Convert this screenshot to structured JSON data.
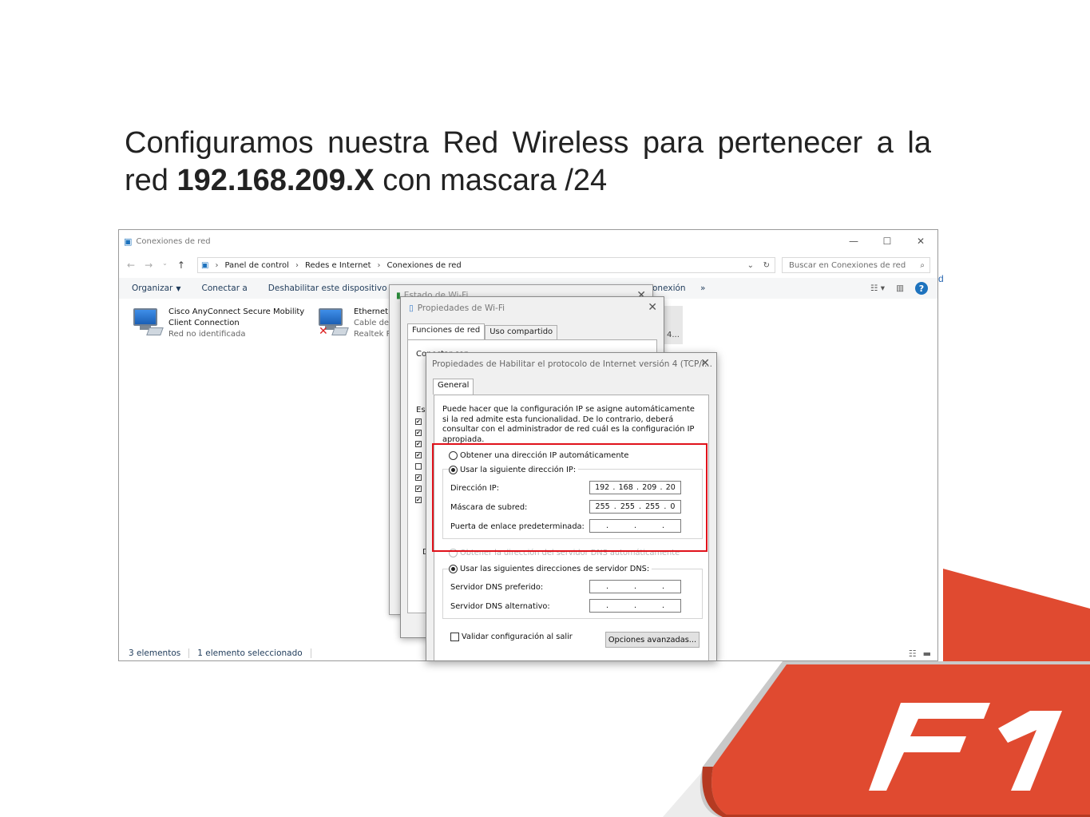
{
  "slide": {
    "title_part1": "Configuramos nuestra Red Wireless para pertenecer a la red ",
    "title_bold": "192.168.209.X",
    "title_part2": " con mascara /24"
  },
  "explorer": {
    "title": "Conexiones de red",
    "breadcrumb": [
      "Panel de control",
      "Redes e Internet",
      "Conexiones de red"
    ],
    "search_placeholder": "Buscar en Conexiones de red",
    "toolbar": {
      "organize": "Organizar",
      "connect": "Conectar a",
      "disable": "Deshabilitar este dispositivo de r",
      "connection_frag": "onexión",
      "more": "»"
    },
    "connections": [
      {
        "name_line1": "Cisco AnyConnect Secure Mobility",
        "name_line2": "Client Connection",
        "status": "Red no identificada"
      },
      {
        "name_line1": "Ethernet",
        "name_line2": "Cable de",
        "status": "Realtek P"
      }
    ],
    "tile_fragment": "4...",
    "status": {
      "count": "3 elementos",
      "selected": "1 elemento seleccionado"
    }
  },
  "wifi_status": {
    "title": "Estado de Wi-Fi"
  },
  "wifi_props": {
    "title": "Propiedades de Wi-Fi",
    "tabs": [
      "Funciones de red",
      "Uso compartido"
    ],
    "connect_frag": "Conectar con:",
    "items_frag": "Es",
    "d_frag": "D"
  },
  "ipv4": {
    "title": "Propiedades de Habilitar el protocolo de Internet versión 4 (TCP/I...",
    "tab": "General",
    "description": "Puede hacer que la configuración IP se asigne automáticamente si la red admite esta funcionalidad. De lo contrario, deberá consultar con el administrador de red cuál es la configuración IP apropiada.",
    "auto_ip": "Obtener una dirección IP automáticamente",
    "manual_ip": "Usar la siguiente dirección IP:",
    "ip_label": "Dirección IP:",
    "ip_value": [
      "192",
      "168",
      "209",
      "20"
    ],
    "mask_label": "Máscara de subred:",
    "mask_value": [
      "255",
      "255",
      "255",
      "0"
    ],
    "gateway_label": "Puerta de enlace predeterminada:",
    "auto_dns": "Obtener la dirección del servidor DNS automáticamente",
    "manual_dns": "Usar las siguientes direcciones de servidor DNS:",
    "dns1_label": "Servidor DNS preferido:",
    "dns2_label": "Servidor DNS alternativo:",
    "validate": "Validar configuración al salir",
    "advanced": "Opciones avanzadas..."
  },
  "colors": {
    "highlight": "#e0121b",
    "f1_key": "#e04a30"
  }
}
